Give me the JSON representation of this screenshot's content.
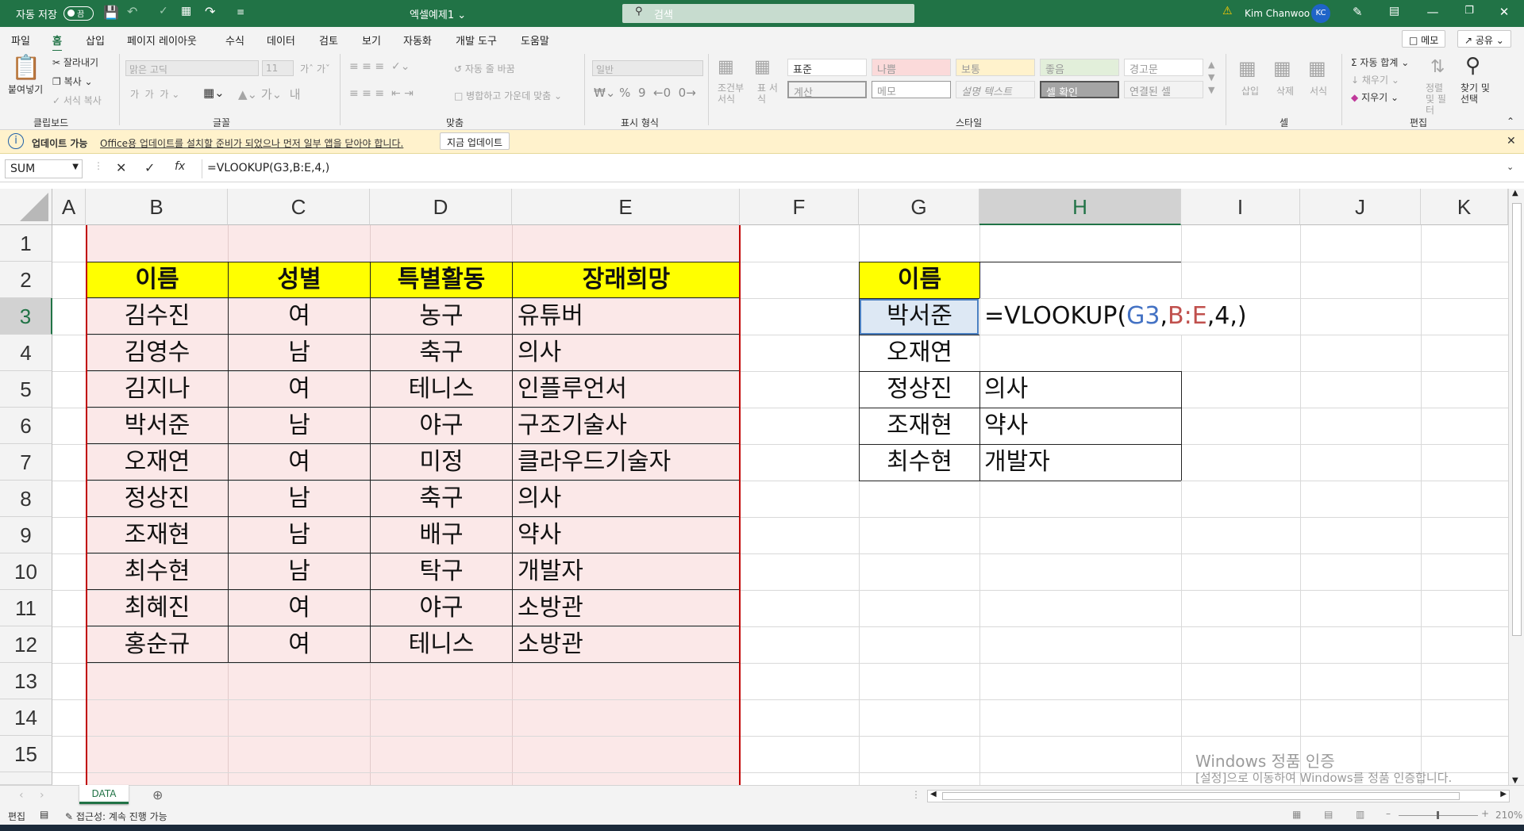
{
  "titlebar": {
    "autosave_label": "자동 저장",
    "toggle_state": "끔",
    "file_name": "엑셀예제1",
    "search_placeholder": "검색",
    "user_name": "Kim Chanwoo",
    "user_initials": "KC"
  },
  "menu": {
    "tabs": [
      "파일",
      "홈",
      "삽입",
      "페이지 레이아웃",
      "수식",
      "데이터",
      "검토",
      "보기",
      "자동화",
      "개발 도구",
      "도움말"
    ],
    "active_tab": "홈",
    "memo_button": "메모",
    "share_button": "공유"
  },
  "ribbon": {
    "clipboard": {
      "paste": "붙여넣기",
      "cut": "잘라내기",
      "copy": "복사",
      "format_painter": "서식 복사",
      "label": "클립보드"
    },
    "font": {
      "font_name": "맑은 고딕",
      "font_size": "11",
      "label": "글꼴"
    },
    "alignment": {
      "wrap_text": "자동 줄 바꿈",
      "merge_center": "병합하고 가운데 맞춤",
      "label": "맞춤"
    },
    "number": {
      "format": "일반",
      "label": "표시 형식"
    },
    "styles": {
      "conditional": "조건부 서식",
      "table": "표 서식",
      "cells": [
        "표준",
        "나쁨",
        "보통",
        "좋음",
        "경고문",
        "계산",
        "메모",
        "설명 텍스트",
        "셀 확인",
        "연결된 셀"
      ],
      "label": "스타일"
    },
    "cells": {
      "insert": "삽입",
      "delete": "삭제",
      "format": "서식",
      "label": "셀"
    },
    "editing": {
      "autosum": "자동 합계",
      "fill": "채우기",
      "clear": "지우기",
      "sort_filter": "정렬 및 필터",
      "find_select": "찾기 및 선택",
      "label": "편집"
    }
  },
  "notice": {
    "title": "업데이트 가능",
    "message": "Office용 업데이트를 설치할 준비가 되었으나 먼저 일부 앱을 닫아야 합니다.",
    "button": "지금 업데이트"
  },
  "formula_bar": {
    "name_box": "SUM",
    "formula": "=VLOOKUP(G3,B:E,4,)"
  },
  "columns": [
    "A",
    "B",
    "C",
    "D",
    "E",
    "F",
    "G",
    "H",
    "I",
    "J",
    "K"
  ],
  "selected_column": "H",
  "rows": [
    "1",
    "2",
    "3",
    "4",
    "5",
    "6",
    "7",
    "8",
    "9",
    "10",
    "11",
    "12",
    "13",
    "14",
    "15"
  ],
  "selected_row": "3",
  "table_headers": [
    "이름",
    "성별",
    "특별활동",
    "장래희망"
  ],
  "table_rows": [
    [
      "김수진",
      "여",
      "농구",
      "유튜버"
    ],
    [
      "김영수",
      "남",
      "축구",
      "의사"
    ],
    [
      "김지나",
      "여",
      "테니스",
      "인플루언서"
    ],
    [
      "박서준",
      "남",
      "야구",
      "구조기술사"
    ],
    [
      "오재연",
      "여",
      "미정",
      "클라우드기술자"
    ],
    [
      "정상진",
      "남",
      "축구",
      "의사"
    ],
    [
      "조재현",
      "남",
      "배구",
      "약사"
    ],
    [
      "최수현",
      "남",
      "탁구",
      "개발자"
    ],
    [
      "최혜진",
      "여",
      "야구",
      "소방관"
    ],
    [
      "홍순규",
      "여",
      "테니스",
      "소방관"
    ]
  ],
  "lookup": {
    "header": "이름",
    "names": [
      "박서준",
      "오재연",
      "정상진",
      "조재현",
      "최수현"
    ],
    "results": [
      "",
      "",
      "의사",
      "약사",
      "개발자"
    ],
    "editing_formula": {
      "prefix": "=VLOOKUP(",
      "ref1": "G3",
      "comma1": ",",
      "ref2": "B:E",
      "suffix": ",4,)"
    }
  },
  "sheet_tabs": [
    "DATA"
  ],
  "status": {
    "mode": "편집",
    "accessibility": "접근성: 계속 진행 가능",
    "zoom": "210%"
  },
  "watermark": {
    "line1": "Windows 정품 인증",
    "line2": "[설정]으로 이동하여 Windows를 정품 인증합니다."
  },
  "colors": {
    "excel_green": "#217346",
    "header_yellow": "#ffff00",
    "table_pink": "#fbe8e8",
    "ref_blue": "#4472c4",
    "ref_red": "#c0504d"
  }
}
